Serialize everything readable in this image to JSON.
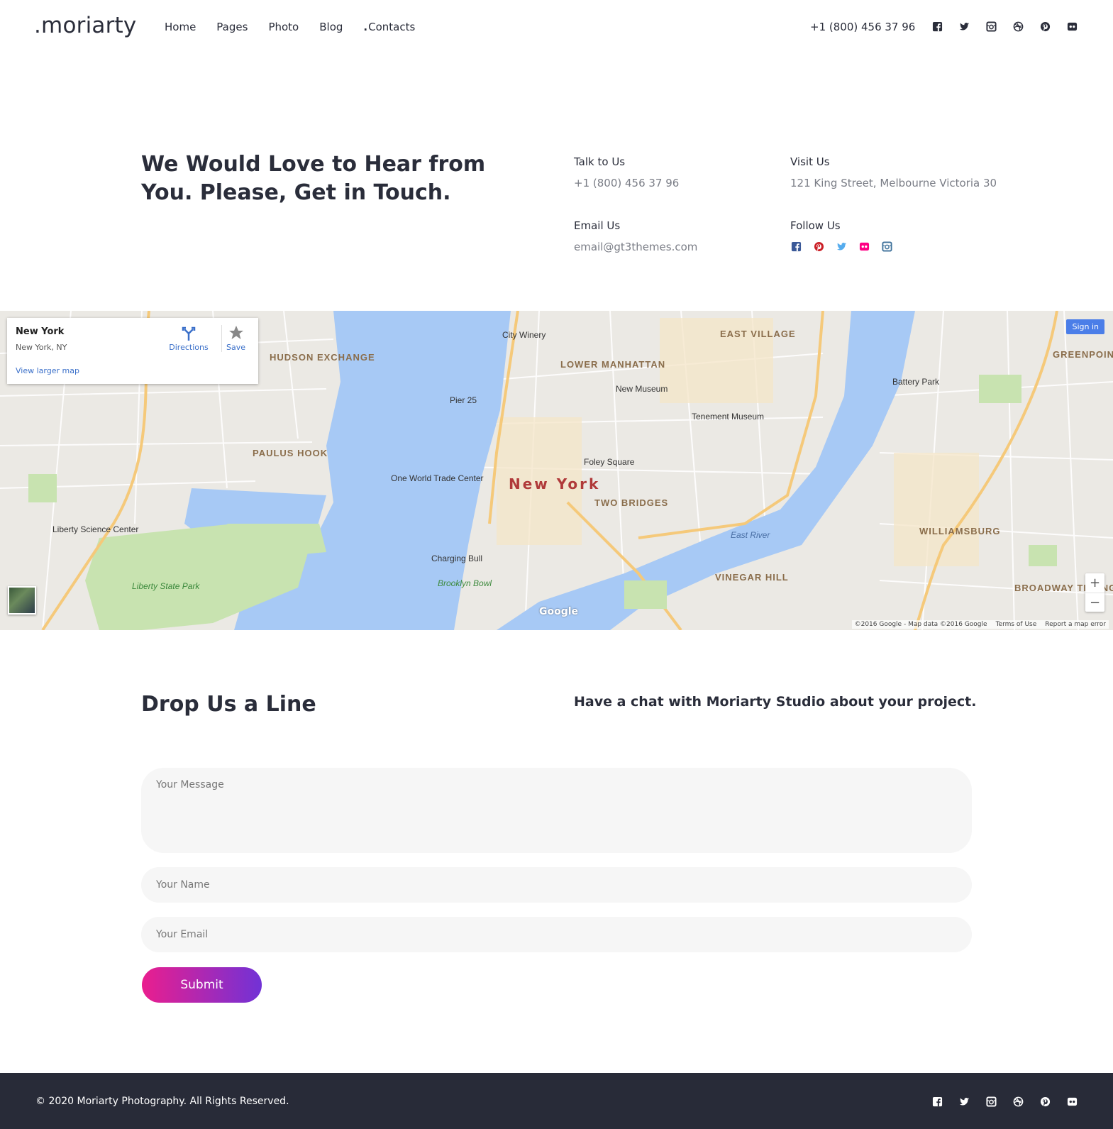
{
  "header": {
    "logo": ".moriarty",
    "nav": [
      {
        "label": "Home"
      },
      {
        "label": "Pages"
      },
      {
        "label": "Photo"
      },
      {
        "label": "Blog"
      },
      {
        "label": "Contacts"
      }
    ],
    "active_nav": "Contacts",
    "phone": "+1 (800) 456 37 96",
    "social_icons": [
      "facebook-icon",
      "twitter-icon",
      "instagram-icon",
      "dribbble-icon",
      "pinterest-icon",
      "flickr-icon"
    ]
  },
  "intro": {
    "title": "We Would Love to Hear from You. Please, Get in Touch.",
    "talk_label": "Talk to Us",
    "talk_value": "+1 (800) 456 37 96",
    "visit_label": "Visit Us",
    "visit_value": "121 King Street, Melbourne Victoria 30",
    "email_label": "Email Us",
    "email_value": "email@gt3themes.com",
    "follow_label": "Follow Us",
    "follow_icons": [
      "facebook-icon",
      "pinterest-icon",
      "twitter-icon",
      "flickr-icon",
      "instagram-icon"
    ]
  },
  "map": {
    "place_name": "New York",
    "place_address": "New York, NY",
    "directions_label": "Directions",
    "save_label": "Save",
    "larger_map_label": "View larger map",
    "sign_in_label": "Sign in",
    "city_label": "New York",
    "google_label": "Google",
    "attribution": "©2016 Google - Map data ©2016 Google",
    "terms_label": "Terms of Use",
    "report_label": "Report a map error",
    "zoom_in": "+",
    "zoom_out": "−",
    "labels": [
      "EAST VILLAGE",
      "LOWER MANHATTAN",
      "HUDSON EXCHANGE",
      "PAULUS HOOK",
      "TWO BRIDGES",
      "VINEGAR HILL",
      "WILLIAMSBURG",
      "GREENPOINT",
      "BROADWAY TRIANGLE",
      "City Winery",
      "Pier 25",
      "New Museum",
      "Tenement Museum",
      "Foley Square",
      "One World Trade Center",
      "Liberty Science Center",
      "Liberty State Park",
      "Battery Park",
      "Brooklyn Bowl",
      "East River",
      "Charging Bull"
    ]
  },
  "contact_form": {
    "title": "Drop Us a Line",
    "subtitle": "Have a chat with Moriarty Studio about your project.",
    "message_placeholder": "Your Message",
    "name_placeholder": "Your Name",
    "email_placeholder": "Your Email",
    "submit_label": "Submit"
  },
  "footer": {
    "copyright": "© 2020 Moriarty Photography. All Rights Reserved.",
    "social_icons": [
      "facebook-icon",
      "twitter-icon",
      "instagram-icon",
      "dribbble-icon",
      "pinterest-icon",
      "flickr-icon"
    ]
  },
  "colors": {
    "text_dark": "#2a2d3a",
    "text_muted": "#7a7d86",
    "footer_bg": "#282b38",
    "button_gradient_start": "#ea1e8e",
    "button_gradient_end": "#7132d6",
    "facebook": "#3b5998",
    "pinterest": "#cb2027",
    "twitter": "#55acee",
    "flickr": "#ff0084",
    "instagram": "#3f729b"
  }
}
